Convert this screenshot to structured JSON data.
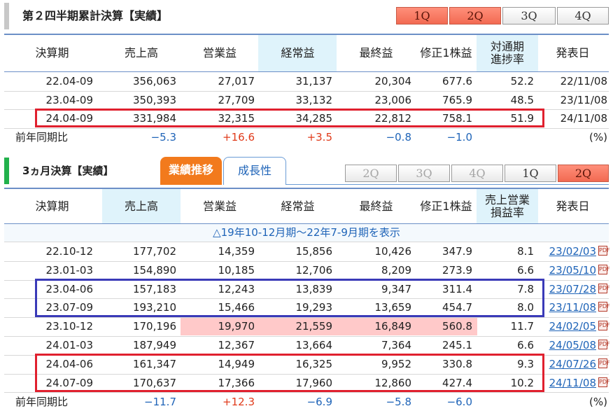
{
  "section1": {
    "title": "第２四半期累計決算【実績】",
    "bar_color": "#c8c8c8",
    "quarter_buttons": [
      "1Q",
      "2Q",
      "3Q",
      "4Q"
    ],
    "headers": [
      "決算期",
      "売上高",
      "営業益",
      "経常益",
      "最終益",
      "修正1株益",
      "対通期\n進捗率",
      "発表日"
    ],
    "rows": [
      [
        "22.04-09",
        "356,063",
        "27,017",
        "31,137",
        "20,304",
        "677.6",
        "52.2",
        "22/11/08"
      ],
      [
        "23.04-09",
        "350,393",
        "27,709",
        "33,132",
        "23,006",
        "765.9",
        "48.5",
        "23/11/08"
      ],
      [
        "24.04-09",
        "331,984",
        "32,315",
        "34,285",
        "22,812",
        "758.1",
        "51.9",
        "24/11/08"
      ]
    ],
    "yoy": [
      "前年同期比",
      "−5.3",
      "+16.6",
      "+3.5",
      "−0.8",
      "−1.0",
      "",
      "(%)"
    ]
  },
  "section2": {
    "title": "3ヵ月決算【実績】",
    "bar_color": "#22b14c",
    "tabs": [
      "業績推移",
      "成長性"
    ],
    "quarter_buttons": [
      "2Q",
      "3Q",
      "4Q",
      "1Q",
      "2Q"
    ],
    "headers": [
      "決算期",
      "売上高",
      "営業益",
      "経常益",
      "最終益",
      "修正1株益",
      "売上営業\n損益率",
      "発表日"
    ],
    "toggle_text": "△19年10-12月期～22年7-9月期を表示",
    "rows": [
      [
        "22.10-12",
        "177,702",
        "14,359",
        "15,856",
        "10,426",
        "347.9",
        "8.1",
        "23/02/03"
      ],
      [
        "23.01-03",
        "154,890",
        "10,185",
        "12,706",
        "8,209",
        "273.9",
        "6.6",
        "23/05/10"
      ],
      [
        "23.04-06",
        "157,183",
        "12,243",
        "13,839",
        "9,347",
        "311.4",
        "7.8",
        "23/07/28"
      ],
      [
        "23.07-09",
        "193,210",
        "15,466",
        "19,293",
        "13,659",
        "454.7",
        "8.0",
        "23/11/08"
      ],
      [
        "23.10-12",
        "170,196",
        "19,970",
        "21,559",
        "16,849",
        "560.8",
        "11.7",
        "24/02/05"
      ],
      [
        "24.01-03",
        "187,949",
        "12,367",
        "13,664",
        "7,364",
        "245.1",
        "6.6",
        "24/05/08"
      ],
      [
        "24.04-06",
        "161,347",
        "14,949",
        "16,325",
        "9,952",
        "330.8",
        "9.3",
        "24/07/26"
      ],
      [
        "24.07-09",
        "170,637",
        "17,366",
        "17,960",
        "12,860",
        "427.4",
        "10.2",
        "24/11/08"
      ]
    ],
    "yoy": [
      "前年同期比",
      "−11.7",
      "+12.3",
      "−6.9",
      "−5.8",
      "−6.0",
      "",
      "(%)"
    ]
  },
  "colors": {
    "highlight_header": "#dff3fb",
    "highlight_cell": "#ffc9c9",
    "red_box": "#e0202e",
    "blue_box": "#3a3ab8"
  }
}
